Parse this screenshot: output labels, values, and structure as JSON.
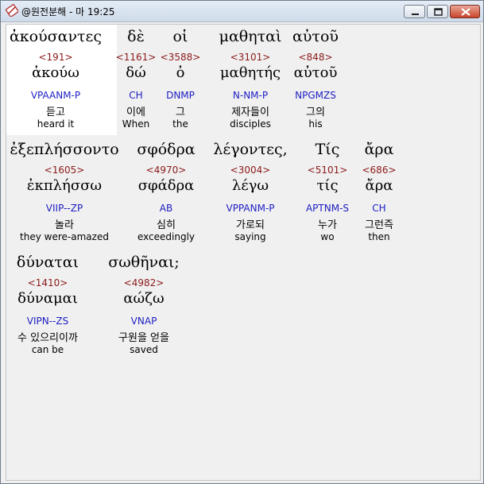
{
  "window": {
    "title": "@원전분해 - 마 19:25",
    "icon": "dictionary-app-icon"
  },
  "rows": [
    {
      "words": [
        {
          "greek": "ἀκούσαντες",
          "strong": "<191>",
          "lemma": "ἀκούω",
          "parse": "VPAANM-P",
          "korean": "듣고",
          "english": "heard it"
        },
        {
          "greek": "δὲ",
          "strong": "<1161>",
          "lemma": "δώ",
          "parse": "CH",
          "korean": "이에",
          "english": "When"
        },
        {
          "greek": "οἱ",
          "strong": "<3588>",
          "lemma": "ὁ",
          "parse": "DNMP",
          "korean": "그",
          "english": "the"
        },
        {
          "greek": "μαθηταὶ",
          "strong": "<3101>",
          "lemma": "μαθητής",
          "parse": "N-NM-P",
          "korean": "제자들이",
          "english": "disciples"
        },
        {
          "greek": "αὐτοῦ",
          "strong": "<848>",
          "lemma": "αὐτοῦ",
          "parse": "NPGMZS",
          "korean": "그의",
          "english": "his"
        }
      ]
    },
    {
      "words": [
        {
          "greek": "ἐξεπλήσσοντο",
          "strong": "<1605>",
          "lemma": "ἐκπλήσσω",
          "parse": "VIIP--ZP",
          "korean": "놀라",
          "english": "they were-amazed"
        },
        {
          "greek": "σφόδρα",
          "strong": "<4970>",
          "lemma": "σφάδρα",
          "parse": "AB",
          "korean": "심히",
          "english": "exceedingly"
        },
        {
          "greek": "λέγοντες,",
          "strong": "<3004>",
          "lemma": "λέγω",
          "parse": "VPPANM-P",
          "korean": "가로되",
          "english": "saying"
        },
        {
          "greek": "Τίς",
          "strong": "<5101>",
          "lemma": "τίς",
          "parse": "APTNM-S",
          "korean": "누가",
          "english": "wo"
        },
        {
          "greek": "ἄρα",
          "strong": "<686>",
          "lemma": "ἄρα",
          "parse": "CH",
          "korean": "그런즉",
          "english": "then"
        }
      ]
    },
    {
      "words": [
        {
          "greek": "δύναται",
          "strong": "<1410>",
          "lemma": "δύναμαι",
          "parse": "VIPN--ZS",
          "korean": "수 있으리이까",
          "english": "can be"
        },
        {
          "greek": "σωθῆναι;",
          "strong": "<4982>",
          "lemma": "αώζω",
          "parse": "VNAP",
          "korean": "구원을 얻을",
          "english": "saved"
        }
      ]
    }
  ],
  "colors": {
    "strong": "#8b1a1a",
    "parse": "#1d1dc4",
    "highlight": "#ffffff"
  }
}
